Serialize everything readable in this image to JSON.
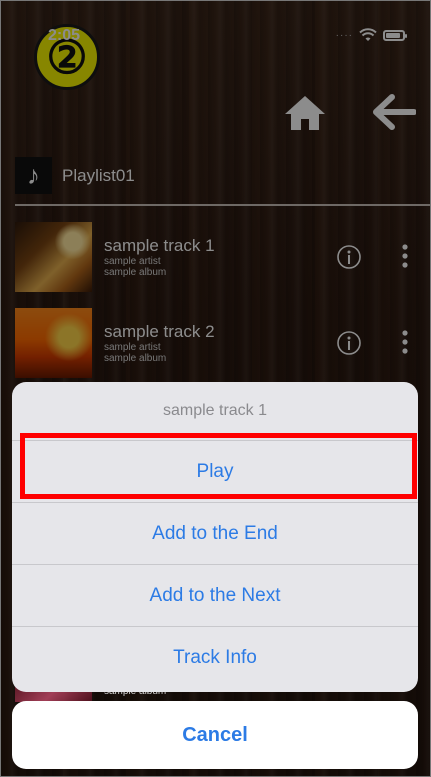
{
  "status": {
    "time": "2:05"
  },
  "badge": {
    "label": "②"
  },
  "playlist": {
    "title": "Playlist01"
  },
  "tracks": [
    {
      "title": "sample track 1",
      "artist": "sample artist",
      "album": "sample album"
    },
    {
      "title": "sample track 2",
      "artist": "sample artist",
      "album": "sample album"
    }
  ],
  "peek": {
    "album": "sample album"
  },
  "action_sheet": {
    "title": "sample track 1",
    "buttons": [
      "Play",
      "Add to the End",
      "Add to the Next",
      "Track Info"
    ],
    "cancel": "Cancel"
  },
  "colors": {
    "accent": "#2c7be5",
    "highlight": "#ff0000",
    "badge": "#f6f400"
  }
}
